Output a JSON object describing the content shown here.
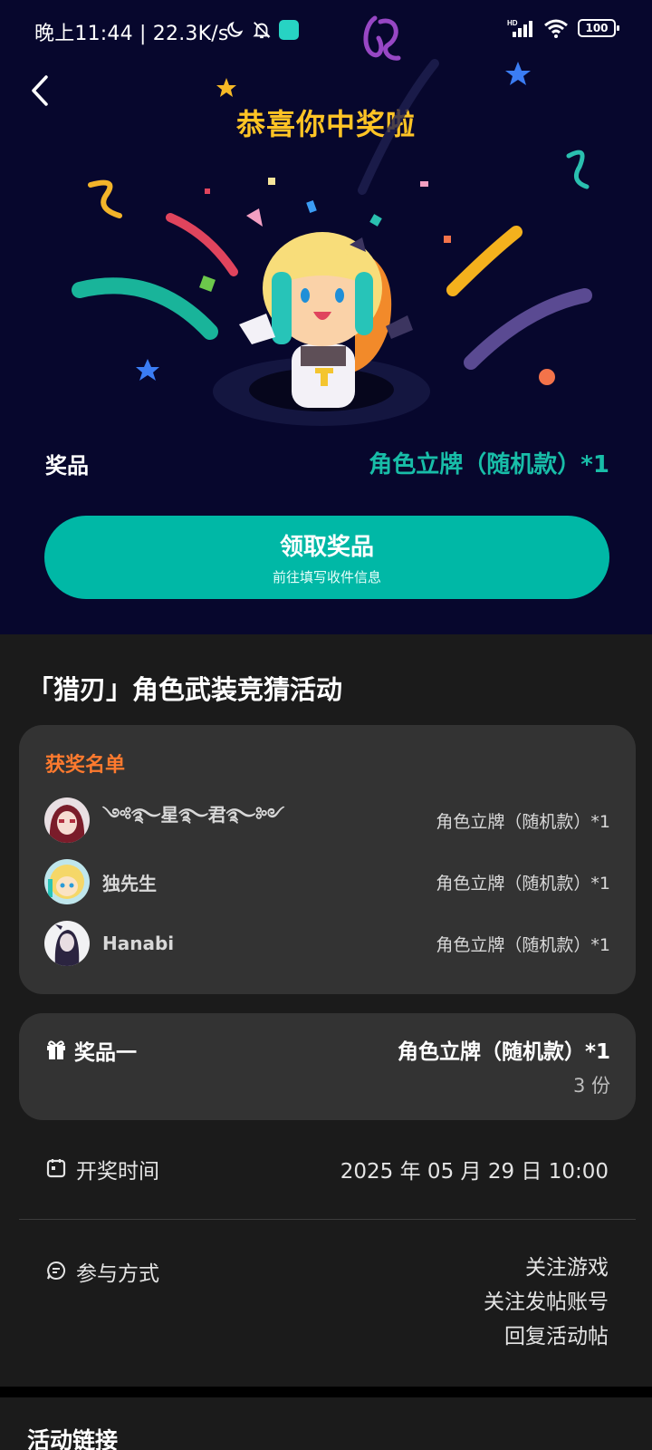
{
  "status_bar": {
    "time_text": "晚上11:44 | 22.3K/s",
    "battery": "100",
    "signal_tag": "HD"
  },
  "hero": {
    "title": "恭喜你中奖啦",
    "prize_label": "奖品",
    "prize_value": "角色立牌（随机款）*1",
    "claim_button": {
      "label": "领取奖品",
      "sublabel": "前往填写收件信息"
    }
  },
  "activity": {
    "title": "「猎刃」角色武装竞猜活动"
  },
  "winners": {
    "heading": "获奖名单",
    "rows": [
      {
        "name": "༺࿐星࿐君࿐༻",
        "prize": "角色立牌（随机款）*1",
        "avatar": "red-haired-girl-avatar"
      },
      {
        "name": "独先生",
        "prize": "角色立牌（随机款）*1",
        "avatar": "blonde-character-avatar"
      },
      {
        "name": "Hanabi",
        "prize": "角色立牌（随机款）*1",
        "avatar": "dark-haired-girl-avatar"
      }
    ]
  },
  "prize_card": {
    "tier": "奖品一",
    "value": "角色立牌（随机款）*1",
    "count": "3 份"
  },
  "draw_time": {
    "label": "开奖时间",
    "value": "2025 年 05 月 29 日 10:00"
  },
  "participation": {
    "label": "参与方式",
    "items": [
      "关注游戏",
      "关注发帖账号",
      "回复活动帖"
    ]
  },
  "links_section": {
    "title": "活动链接"
  },
  "colors": {
    "hero_bg": "#07072d",
    "title_yellow": "#ffc425",
    "accent_teal": "#00b8a6",
    "winners_orange": "#ff7a2e",
    "card_bg": "#333333",
    "page_bg": "#1b1b1b"
  }
}
